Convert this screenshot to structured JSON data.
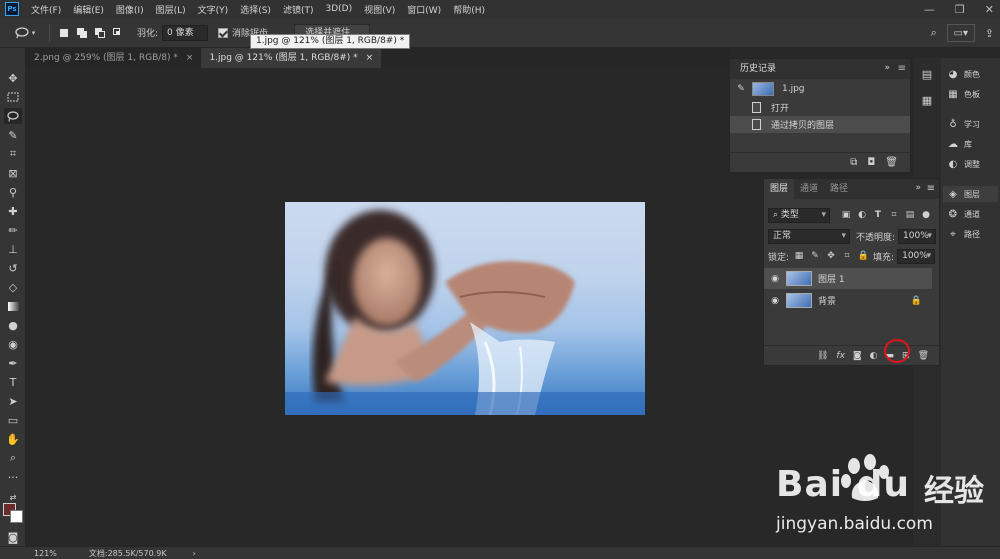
{
  "app": {
    "logo": "Ps"
  },
  "menu": [
    "文件(F)",
    "编辑(E)",
    "图像(I)",
    "图层(L)",
    "文字(Y)",
    "选择(S)",
    "滤镜(T)",
    "3D(D)",
    "视图(V)",
    "窗口(W)",
    "帮助(H)"
  ],
  "window_controls": {
    "minimize": "—",
    "restore": "❐",
    "close": "✕"
  },
  "options": {
    "feather_label": "羽化:",
    "feather_value": "0 像素",
    "antialias_label": "消除锯齿",
    "select_mask_button": "选择并遮住..."
  },
  "tooltip": "1.jpg @ 121% (图层 1, RGB/8#) *",
  "tabs": [
    {
      "label": "2.png @ 259% (图层 1, RGB/8) *",
      "close": "×"
    },
    {
      "label": "1.jpg @ 121% (图层 1, RGB/8#) *",
      "close": "×"
    }
  ],
  "status": {
    "zoom": "121%",
    "doc_info": "文档:285.5K/570.9K",
    "arrow": "›"
  },
  "history": {
    "title": "历史记录",
    "snapshot": "1.jpg",
    "items": [
      "打开",
      "通过拷贝的图层"
    ]
  },
  "right_panels": {
    "group1": [
      "颜色",
      "色板"
    ],
    "group2": [
      "学习",
      "库",
      "调整"
    ],
    "group3": [
      "图层",
      "通道",
      "路径"
    ]
  },
  "layers": {
    "tabs": [
      "图层",
      "通道",
      "路径"
    ],
    "filter_kind": "类型",
    "blend_mode": "正常",
    "opacity_label": "不透明度:",
    "opacity_value": "100%",
    "lock_label": "锁定:",
    "fill_label": "填充:",
    "fill_value": "100%",
    "rows": [
      {
        "name": "图层 1",
        "selected": true
      },
      {
        "name": "背景",
        "locked": true
      }
    ]
  },
  "watermark": {
    "brand": "Bai  du",
    "brand_cn": "经验",
    "url": "jingyan.baidu.com"
  }
}
